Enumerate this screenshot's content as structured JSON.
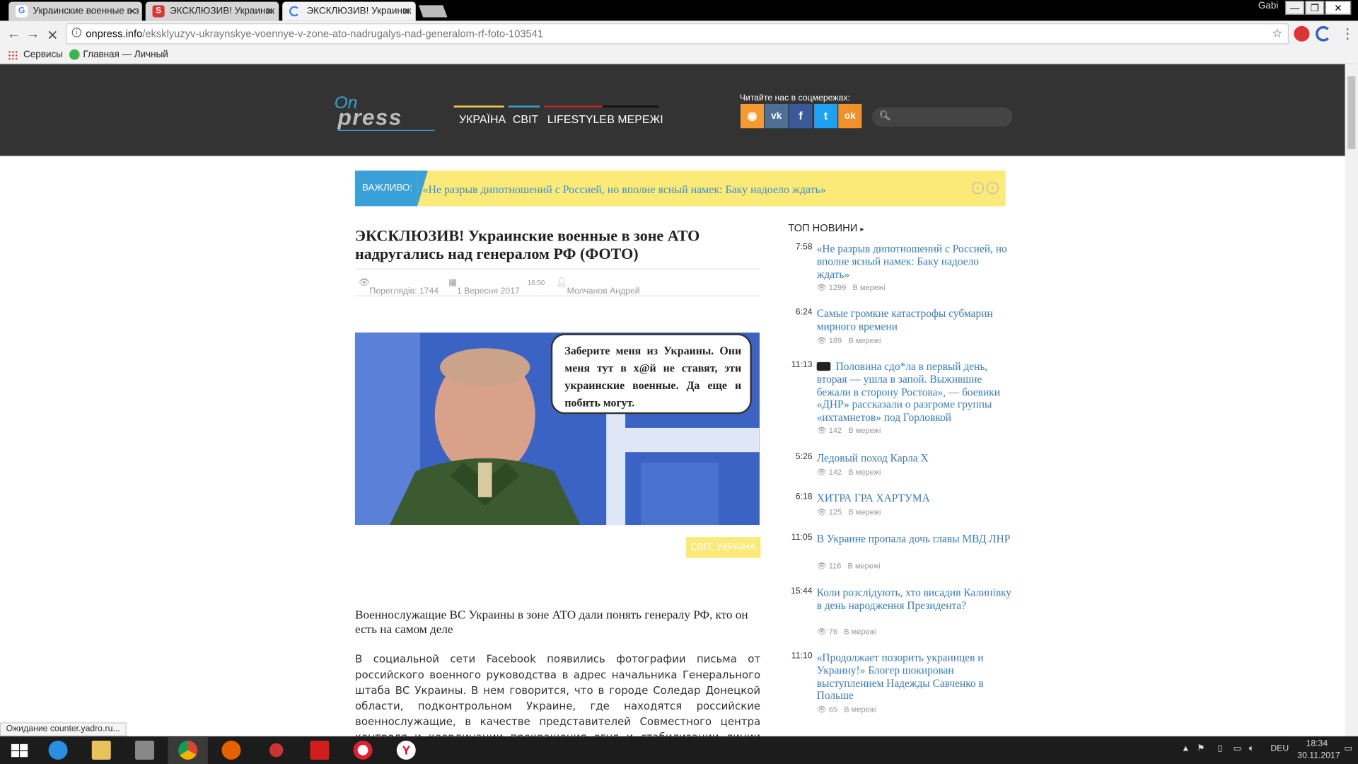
{
  "browser": {
    "tabs": [
      {
        "title": "Украинские военные в з",
        "favicon": "google-g",
        "fav_color": "#fff"
      },
      {
        "title": "ЭКСКЛЮЗИВ! Украинск",
        "favicon": "s-red",
        "fav_color": "#d33"
      },
      {
        "title": "ЭКСКЛЮЗИВ! Украинск",
        "favicon": "loading",
        "fav_color": "#3b82f6"
      }
    ],
    "user": "Gabi",
    "url_host": "onpress.info",
    "url_path": "/eksklyuzyv-ukraynskye-voennye-v-zone-ato-nadrugalys-nad-generalom-rf-foto-103541",
    "bookmarks": [
      {
        "label": "Сервисы"
      },
      {
        "label": "Главная — Личный"
      }
    ],
    "status": "Ожидание counter.yadro.ru..."
  },
  "site": {
    "logo_on": "On",
    "logo_press": "press",
    "menu": [
      {
        "label": "УКРАЇНА",
        "color": "#f5d04a"
      },
      {
        "label": "СВІТ",
        "color": "#3aa0d8"
      },
      {
        "label": "LIFESTYLE",
        "color": "#c0272d"
      },
      {
        "label": "В МЕРЕЖІ",
        "color": "#111111"
      }
    ],
    "social_label": "Читайте нас в соцмережах:",
    "social": [
      {
        "name": "rss-icon",
        "glyph": "◉",
        "color": "#f59a30"
      },
      {
        "name": "vk-icon",
        "glyph": "vk",
        "color": "#4d6f93"
      },
      {
        "name": "facebook-icon",
        "glyph": "f",
        "color": "#3b5998"
      },
      {
        "name": "twitter-icon",
        "glyph": "t",
        "color": "#1da1f2"
      },
      {
        "name": "odnoklassniki-icon",
        "glyph": "ok",
        "color": "#f0912b"
      }
    ],
    "search_placeholder": ""
  },
  "important": {
    "label": "ВАЖЛИВО:",
    "text": "«Не разрыв дипотношений с Россией, но вполне ясный намек: Баку надоело ждать»"
  },
  "article": {
    "title": "ЭКСКЛЮЗИВ! Украинские военные в зоне АТО надругались над генералом РФ (ФОТО)",
    "views_label": "Переглядів: 1744",
    "date": "1 Вересня 2017",
    "time": "16:50",
    "author": "Молчанов Андрей",
    "bubble_text": "Заберите меня из Украины. Они меня тут в х@й не ставят, эти украинские военные. Да еще и побить могут.",
    "category": "СВІТ, УКРАЇНА",
    "lead": "Военнослужащие ВС Украины в зоне АТО дали понять генералу РФ, кто он есть на самом деле",
    "body": "В социальной сети Facebook появились фотографии письма от российского военного руководства в адрес начальника Генерального штаба ВС Украины. В нем говорится, что в городе Соледар Донецкой области, подконтрольном Украине, где находятся российские военнослужащие, в качестве представителей Совместного центра контроля и координации прекращения огня и стабилизации линии соприкосновения сторон (СЦКК), произошел"
  },
  "top_news": {
    "title": "ТОП НОВИНИ",
    "items": [
      {
        "time": "7:58",
        "text": "«Не разрыв дипотношений с Россией, но вполне ясный намек: Баку надоело ждать»",
        "views": "1299",
        "cat": "В мережі",
        "video": false
      },
      {
        "time": "6:24",
        "text": "Самые громкие катастрофы субмарин мирного времени",
        "views": "189",
        "cat": "В мережі",
        "video": false
      },
      {
        "time": "11:13",
        "text": "Половина сдо*ла в первый день, вторая — ушла в запой. Выжившие бежали в сторону Ростова», — боевики «ДНР» рассказали о разгроме группы «ихтамнетов» под Горловкой",
        "views": "142",
        "cat": "В мережі",
        "video": true
      },
      {
        "time": "5:26",
        "text": "Ледовый поход Карла Х",
        "views": "142",
        "cat": "В мережі",
        "video": false
      },
      {
        "time": "6:18",
        "text": "ХИТРА ГРА ХАРТУМА",
        "views": "125",
        "cat": "В мережі",
        "video": false
      },
      {
        "time": "11:05",
        "text": "В Украине пропала дочь главы МВД ЛНР",
        "views": "116",
        "cat": "В мережі",
        "video": false
      },
      {
        "time": "15:44",
        "text": "Коли розслідують, хто висадив Калинівку в день народження Президента?",
        "views": "76",
        "cat": "В мережі",
        "video": false
      },
      {
        "time": "11:10",
        "text": "«Продолжает позорить украинцев и Украину!» Блогер шокирован выступлением Надежды Савченко в Польше",
        "views": "65",
        "cat": "В мережі",
        "video": false
      }
    ]
  },
  "taskbar": {
    "apps": [
      {
        "name": "start-icon"
      },
      {
        "name": "internet-explorer-icon"
      },
      {
        "name": "file-explorer-icon"
      },
      {
        "name": "scanner-icon"
      },
      {
        "name": "chrome-icon"
      },
      {
        "name": "firefox-icon"
      },
      {
        "name": "snipping-tool-icon"
      },
      {
        "name": "acrobat-icon"
      },
      {
        "name": "opera-icon"
      },
      {
        "name": "yandex-icon"
      }
    ],
    "lang": "DEU",
    "time": "18:34",
    "date": "30.11.2017"
  }
}
